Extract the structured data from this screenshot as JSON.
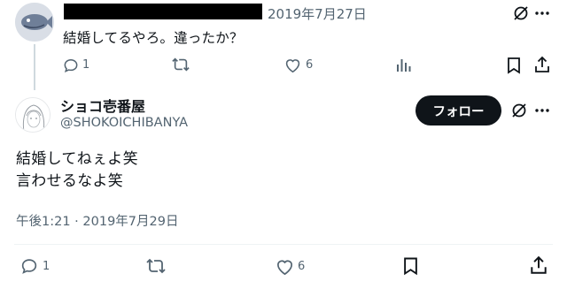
{
  "parent_tweet": {
    "date": "2019年7月27日",
    "text": "結婚してるやろ。違ったか？",
    "actions": {
      "reply_count": "1",
      "like_count": "6"
    }
  },
  "main_tweet": {
    "display_name": "ショコ壱番屋",
    "handle": "@SHOKOICHIBANYA",
    "follow_label": "フォロー",
    "text_line1": "結婚してねぇよ笑",
    "text_line2": "言わせるなよ笑",
    "timestamp": "午後1:21 · 2019年7月29日",
    "actions": {
      "reply_count": "1",
      "like_count": "6"
    }
  },
  "colors": {
    "text": "#0f1419",
    "muted": "#536471",
    "divider": "#eff3f4",
    "follow_bg": "#0f1419"
  }
}
